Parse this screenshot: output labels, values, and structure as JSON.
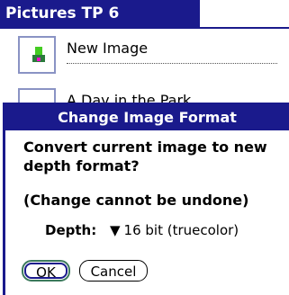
{
  "app": {
    "title": "Pictures TP 6",
    "items": [
      {
        "name": "New Image"
      },
      {
        "name": "A Day in the Park"
      }
    ]
  },
  "dialog": {
    "title": "Change Image Format",
    "message": "Convert current image to new depth format?",
    "warning": "(Change cannot be undone)",
    "depth_label": "Depth:",
    "depth_value": "16 bit (truecolor)",
    "ok_label": "OK",
    "cancel_label": "Cancel"
  },
  "colors": {
    "title_bar": "#1a1a8c",
    "ok_button_border": "#3c7a5c"
  }
}
